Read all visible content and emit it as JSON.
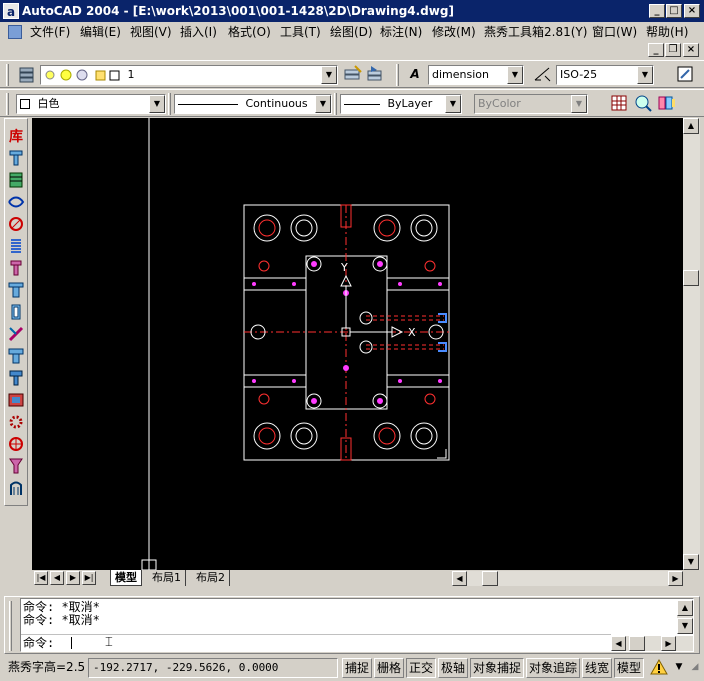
{
  "window": {
    "title": "AutoCAD 2004 - [E:\\work\\2013\\001\\001-1428\\2D\\Drawing4.dwg]",
    "app_icon": "a",
    "controls": {
      "minimize": "_",
      "restore": "□",
      "close": "×"
    },
    "doc_controls": {
      "minimize": "_",
      "restore": "❐",
      "close": "×"
    }
  },
  "menubar": {
    "items": [
      "文件(F)",
      "编辑(E)",
      "视图(V)",
      "插入(I)",
      "格式(O)",
      "工具(T)",
      "绘图(D)",
      "标注(N)",
      "修改(M)",
      "燕秀工具箱2.81(Y)",
      "窗口(W)",
      "帮助(H)"
    ]
  },
  "layers_toolbar": {
    "layer_value": "1",
    "dimstyle_value": "dimension",
    "dimstyle2_value": "ISO-25"
  },
  "properties_toolbar": {
    "color_value": "白色",
    "linetype_value": "Continuous",
    "lineweight_value": "ByLayer",
    "plotstyle_value": "ByColor"
  },
  "left_tools": {
    "top_label": "库"
  },
  "drawing": {
    "ucs_y": "Y",
    "ucs_x": "X",
    "accent_red": "#ff3030",
    "accent_white": "#ffffff",
    "accent_magenta": "#ff3cff"
  },
  "tabs": {
    "items": [
      "模型",
      "布局1",
      "布局2"
    ]
  },
  "command": {
    "history": [
      "命令: *取消*",
      "命令: *取消*"
    ],
    "prompt": "命令:"
  },
  "statusbar": {
    "text_height": "燕秀字高=2.5",
    "coordinates": "-192.2717, -229.5626, 0.0000",
    "toggles": [
      "捕捉",
      "栅格",
      "正交",
      "极轴",
      "对象捕捉",
      "对象追踪",
      "线宽",
      "模型"
    ]
  }
}
